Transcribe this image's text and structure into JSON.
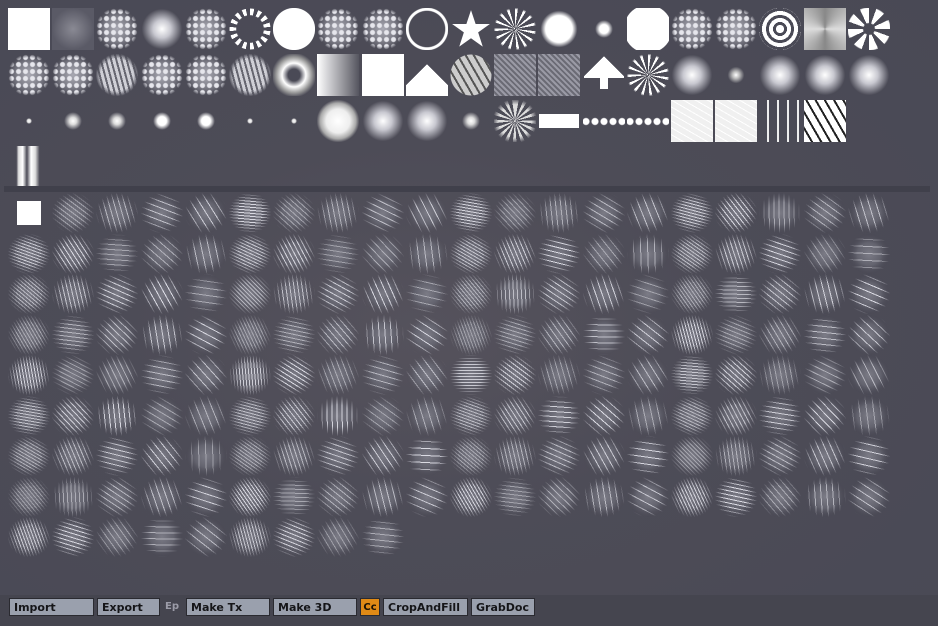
{
  "palette": {
    "preset_alphas": [
      "white-square",
      "soft-gray-square",
      "noise-disc",
      "soft-disc",
      "speckle-disc",
      "dotted-ring",
      "white-disc",
      "dots-disc",
      "sparse-dots-disc",
      "ring",
      "star",
      "starburst",
      "soft-white-disc",
      "small-dot",
      "large-white-disc",
      "fuzzy-disc",
      "speckle-disc",
      "target-rings",
      "x-gradient-square",
      "swirl",
      "fuzzy-square",
      "fuzzy-cluster",
      "crackle-disc",
      "dots-cluster",
      "dots-disc",
      "cells-disc",
      "donut",
      "gradient-square",
      "white-square",
      "tree-stack",
      "hex-ball",
      "noise-square",
      "pebble-square",
      "arrow-up",
      "starburst",
      "soft-disc",
      "small-soft-disc",
      "soft-disc",
      "soft-disc",
      "soft-disc",
      "tiny-dot",
      "soft-dot",
      "soft-dot",
      "small-dot",
      "small-dot",
      "tiny-dot",
      "tiny-dot",
      "large-soft-disc",
      "soft-disc",
      "soft-disc",
      "soft-dot",
      "sun-spikes",
      "ornament-bar",
      "dot-chain",
      "dot-chain",
      "scribble-square",
      "scribble-square",
      "vertical-cracks",
      "cracked-tiles",
      "vertical-stripes"
    ],
    "texture_count": 169
  },
  "toolbar": {
    "import_label": "Import",
    "export_label": "Export",
    "ep_label": "Ep",
    "make_tx_label": "Make Tx",
    "make_3d_label": "Make 3D",
    "cc_label": "Cc",
    "cropandfill_label": "CropAndFill",
    "grabdoc_label": "GrabDoc"
  },
  "colors": {
    "background": "#4a4a56",
    "button": "#9aa0ad",
    "button_dim": "#6f7280",
    "cc_active": "#e08a16"
  }
}
